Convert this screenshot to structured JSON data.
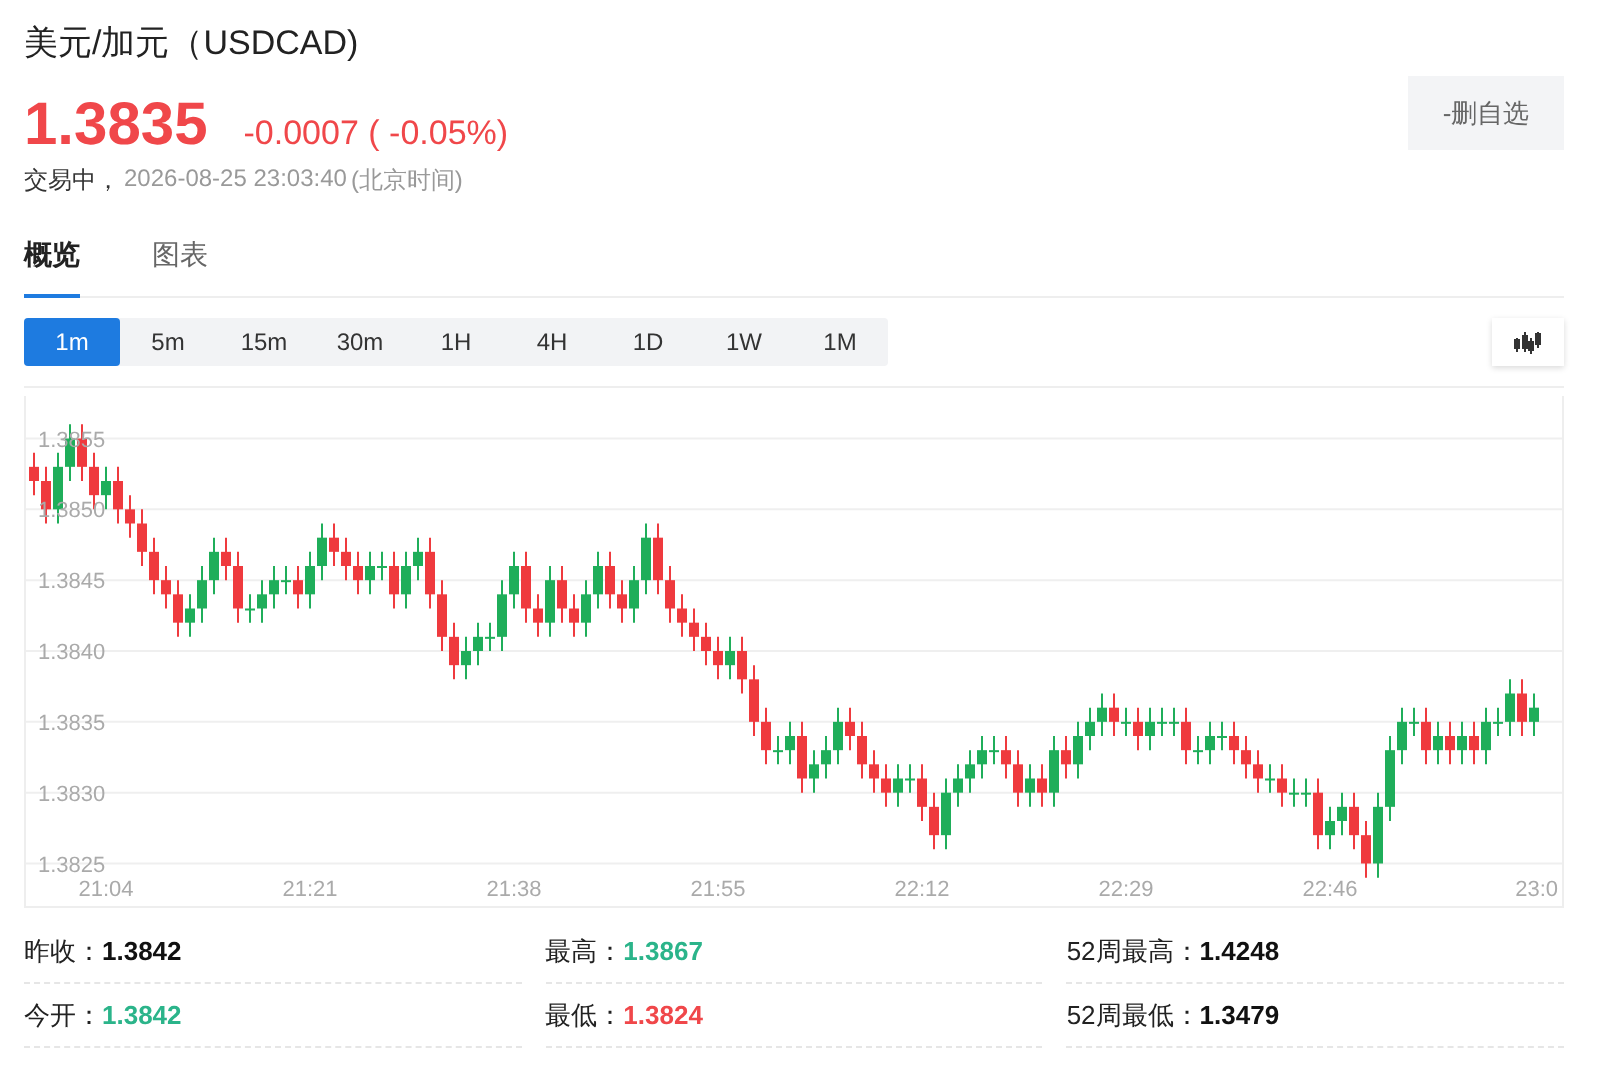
{
  "header": {
    "title": "美元/加元（USDCAD)",
    "price": "1.3835",
    "change": "-0.0007 ( -0.05%)",
    "status": "交易中，",
    "time": "2026-08-25 23:03:40",
    "timezone": "(北京时间)",
    "watch_button": "-删自选"
  },
  "tabs": [
    {
      "label": "概览",
      "selected": true
    },
    {
      "label": "图表",
      "selected": false
    }
  ],
  "intervals": [
    {
      "label": "1m",
      "selected": true
    },
    {
      "label": "5m",
      "selected": false
    },
    {
      "label": "15m",
      "selected": false
    },
    {
      "label": "30m",
      "selected": false
    },
    {
      "label": "1H",
      "selected": false
    },
    {
      "label": "4H",
      "selected": false
    },
    {
      "label": "1D",
      "selected": false
    },
    {
      "label": "1W",
      "selected": false
    },
    {
      "label": "1M",
      "selected": false
    }
  ],
  "chart": {
    "chart_data": {
      "type": "candlestick",
      "ylim": [
        1.3822,
        1.3858
      ],
      "grid": true,
      "categories": [
        null,
        null,
        null,
        null,
        null,
        null,
        "21:04",
        null,
        null,
        null,
        null,
        null,
        null,
        null,
        null,
        null,
        null,
        null,
        null,
        null,
        null,
        null,
        null,
        "21:21",
        null,
        null,
        null,
        null,
        null,
        null,
        null,
        null,
        null,
        null,
        null,
        null,
        null,
        null,
        null,
        null,
        "21:38",
        null,
        null,
        null,
        null,
        null,
        null,
        null,
        null,
        null,
        null,
        null,
        null,
        null,
        null,
        null,
        null,
        "21:55",
        null,
        null,
        null,
        null,
        null,
        null,
        null,
        null,
        null,
        null,
        null,
        null,
        null,
        null,
        null,
        null,
        "22:12",
        null,
        null,
        null,
        null,
        null,
        null,
        null,
        null,
        null,
        null,
        null,
        null,
        null,
        null,
        null,
        null,
        "22:29",
        null,
        null,
        null,
        null,
        null,
        null,
        null,
        null,
        null,
        null,
        null,
        null,
        null,
        null,
        null,
        null,
        "22:46",
        null,
        null,
        null,
        null,
        null,
        null,
        null,
        null,
        null,
        null,
        null,
        null,
        null,
        null,
        null,
        null,
        "23:0"
      ],
      "yticks": [
        {
          "value": 1.3855,
          "label": "1.3855"
        },
        {
          "value": 1.385,
          "label": "1.3850"
        },
        {
          "value": 1.3845,
          "label": "1.3845"
        },
        {
          "value": 1.384,
          "label": "1.3840"
        },
        {
          "value": 1.3835,
          "label": "1.3835"
        },
        {
          "value": 1.383,
          "label": "1.3830"
        },
        {
          "value": 1.3825,
          "label": "1.3825"
        }
      ],
      "ohlc": [
        [
          1.3853,
          1.3854,
          1.3851,
          1.3852
        ],
        [
          1.3852,
          1.3853,
          1.3849,
          1.385
        ],
        [
          1.385,
          1.3854,
          1.3849,
          1.3853
        ],
        [
          1.3853,
          1.3856,
          1.3852,
          1.3855
        ],
        [
          1.3855,
          1.3856,
          1.3852,
          1.3853
        ],
        [
          1.3853,
          1.3854,
          1.385,
          1.3851
        ],
        [
          1.3851,
          1.3853,
          1.385,
          1.3852
        ],
        [
          1.3852,
          1.3853,
          1.3849,
          1.385
        ],
        [
          1.385,
          1.3851,
          1.3848,
          1.3849
        ],
        [
          1.3849,
          1.385,
          1.3846,
          1.3847
        ],
        [
          1.3847,
          1.3848,
          1.3844,
          1.3845
        ],
        [
          1.3845,
          1.3846,
          1.3843,
          1.3844
        ],
        [
          1.3844,
          1.3845,
          1.3841,
          1.3842
        ],
        [
          1.3842,
          1.3844,
          1.3841,
          1.3843
        ],
        [
          1.3843,
          1.3846,
          1.3842,
          1.3845
        ],
        [
          1.3845,
          1.3848,
          1.3844,
          1.3847
        ],
        [
          1.3847,
          1.3848,
          1.3845,
          1.3846
        ],
        [
          1.3846,
          1.3847,
          1.3842,
          1.3843
        ],
        [
          1.3843,
          1.3844,
          1.3842,
          1.3843
        ],
        [
          1.3843,
          1.3845,
          1.3842,
          1.3844
        ],
        [
          1.3844,
          1.3846,
          1.3843,
          1.3845
        ],
        [
          1.3845,
          1.3846,
          1.3844,
          1.3845
        ],
        [
          1.3845,
          1.3846,
          1.3843,
          1.3844
        ],
        [
          1.3844,
          1.3847,
          1.3843,
          1.3846
        ],
        [
          1.3846,
          1.3849,
          1.3845,
          1.3848
        ],
        [
          1.3848,
          1.3849,
          1.3846,
          1.3847
        ],
        [
          1.3847,
          1.3848,
          1.3845,
          1.3846
        ],
        [
          1.3846,
          1.3847,
          1.3844,
          1.3845
        ],
        [
          1.3845,
          1.3847,
          1.3844,
          1.3846
        ],
        [
          1.3846,
          1.3847,
          1.3845,
          1.3846
        ],
        [
          1.3846,
          1.3847,
          1.3843,
          1.3844
        ],
        [
          1.3844,
          1.3847,
          1.3843,
          1.3846
        ],
        [
          1.3846,
          1.3848,
          1.3845,
          1.3847
        ],
        [
          1.3847,
          1.3848,
          1.3843,
          1.3844
        ],
        [
          1.3844,
          1.3845,
          1.384,
          1.3841
        ],
        [
          1.3841,
          1.3842,
          1.3838,
          1.3839
        ],
        [
          1.3839,
          1.3841,
          1.3838,
          1.384
        ],
        [
          1.384,
          1.3842,
          1.3839,
          1.3841
        ],
        [
          1.3841,
          1.3842,
          1.384,
          1.3841
        ],
        [
          1.3841,
          1.3845,
          1.384,
          1.3844
        ],
        [
          1.3844,
          1.3847,
          1.3843,
          1.3846
        ],
        [
          1.3846,
          1.3847,
          1.3842,
          1.3843
        ],
        [
          1.3843,
          1.3844,
          1.3841,
          1.3842
        ],
        [
          1.3842,
          1.3846,
          1.3841,
          1.3845
        ],
        [
          1.3845,
          1.3846,
          1.3842,
          1.3843
        ],
        [
          1.3843,
          1.3844,
          1.3841,
          1.3842
        ],
        [
          1.3842,
          1.3845,
          1.3841,
          1.3844
        ],
        [
          1.3844,
          1.3847,
          1.3843,
          1.3846
        ],
        [
          1.3846,
          1.3847,
          1.3843,
          1.3844
        ],
        [
          1.3844,
          1.3845,
          1.3842,
          1.3843
        ],
        [
          1.3843,
          1.3846,
          1.3842,
          1.3845
        ],
        [
          1.3845,
          1.3849,
          1.3844,
          1.3848
        ],
        [
          1.3848,
          1.3849,
          1.3844,
          1.3845
        ],
        [
          1.3845,
          1.3846,
          1.3842,
          1.3843
        ],
        [
          1.3843,
          1.3844,
          1.3841,
          1.3842
        ],
        [
          1.3842,
          1.3843,
          1.384,
          1.3841
        ],
        [
          1.3841,
          1.3842,
          1.3839,
          1.384
        ],
        [
          1.384,
          1.3841,
          1.3838,
          1.3839
        ],
        [
          1.3839,
          1.3841,
          1.3838,
          1.384
        ],
        [
          1.384,
          1.3841,
          1.3837,
          1.3838
        ],
        [
          1.3838,
          1.3839,
          1.3834,
          1.3835
        ],
        [
          1.3835,
          1.3836,
          1.3832,
          1.3833
        ],
        [
          1.3833,
          1.3834,
          1.3832,
          1.3833
        ],
        [
          1.3833,
          1.3835,
          1.3832,
          1.3834
        ],
        [
          1.3834,
          1.3835,
          1.383,
          1.3831
        ],
        [
          1.3831,
          1.3833,
          1.383,
          1.3832
        ],
        [
          1.3832,
          1.3834,
          1.3831,
          1.3833
        ],
        [
          1.3833,
          1.3836,
          1.3832,
          1.3835
        ],
        [
          1.3835,
          1.3836,
          1.3833,
          1.3834
        ],
        [
          1.3834,
          1.3835,
          1.3831,
          1.3832
        ],
        [
          1.3832,
          1.3833,
          1.383,
          1.3831
        ],
        [
          1.3831,
          1.3832,
          1.3829,
          1.383
        ],
        [
          1.383,
          1.3832,
          1.3829,
          1.3831
        ],
        [
          1.3831,
          1.3832,
          1.383,
          1.3831
        ],
        [
          1.3831,
          1.3832,
          1.3828,
          1.3829
        ],
        [
          1.3829,
          1.383,
          1.3826,
          1.3827
        ],
        [
          1.3827,
          1.3831,
          1.3826,
          1.383
        ],
        [
          1.383,
          1.3832,
          1.3829,
          1.3831
        ],
        [
          1.3831,
          1.3833,
          1.383,
          1.3832
        ],
        [
          1.3832,
          1.3834,
          1.3831,
          1.3833
        ],
        [
          1.3833,
          1.3834,
          1.3832,
          1.3833
        ],
        [
          1.3833,
          1.3834,
          1.3831,
          1.3832
        ],
        [
          1.3832,
          1.3833,
          1.3829,
          1.383
        ],
        [
          1.383,
          1.3832,
          1.3829,
          1.3831
        ],
        [
          1.3831,
          1.3832,
          1.3829,
          1.383
        ],
        [
          1.383,
          1.3834,
          1.3829,
          1.3833
        ],
        [
          1.3833,
          1.3834,
          1.3831,
          1.3832
        ],
        [
          1.3832,
          1.3835,
          1.3831,
          1.3834
        ],
        [
          1.3834,
          1.3836,
          1.3833,
          1.3835
        ],
        [
          1.3835,
          1.3837,
          1.3834,
          1.3836
        ],
        [
          1.3836,
          1.3837,
          1.3834,
          1.3835
        ],
        [
          1.3835,
          1.3836,
          1.3834,
          1.3835
        ],
        [
          1.3835,
          1.3836,
          1.3833,
          1.3834
        ],
        [
          1.3834,
          1.3836,
          1.3833,
          1.3835
        ],
        [
          1.3835,
          1.3836,
          1.3834,
          1.3835
        ],
        [
          1.3835,
          1.3836,
          1.3834,
          1.3835
        ],
        [
          1.3835,
          1.3836,
          1.3832,
          1.3833
        ],
        [
          1.3833,
          1.3834,
          1.3832,
          1.3833
        ],
        [
          1.3833,
          1.3835,
          1.3832,
          1.3834
        ],
        [
          1.3834,
          1.3835,
          1.3833,
          1.3834
        ],
        [
          1.3834,
          1.3835,
          1.3832,
          1.3833
        ],
        [
          1.3833,
          1.3834,
          1.3831,
          1.3832
        ],
        [
          1.3832,
          1.3833,
          1.383,
          1.3831
        ],
        [
          1.3831,
          1.3832,
          1.383,
          1.3831
        ],
        [
          1.3831,
          1.3832,
          1.3829,
          1.383
        ],
        [
          1.383,
          1.3831,
          1.3829,
          1.383
        ],
        [
          1.383,
          1.3831,
          1.3829,
          1.383
        ],
        [
          1.383,
          1.3831,
          1.3826,
          1.3827
        ],
        [
          1.3827,
          1.3829,
          1.3826,
          1.3828
        ],
        [
          1.3828,
          1.383,
          1.3827,
          1.3829
        ],
        [
          1.3829,
          1.383,
          1.3826,
          1.3827
        ],
        [
          1.3827,
          1.3828,
          1.3824,
          1.3825
        ],
        [
          1.3825,
          1.383,
          1.3824,
          1.3829
        ],
        [
          1.3829,
          1.3834,
          1.3828,
          1.3833
        ],
        [
          1.3833,
          1.3836,
          1.3832,
          1.3835
        ],
        [
          1.3835,
          1.3836,
          1.3834,
          1.3835
        ],
        [
          1.3835,
          1.3836,
          1.3832,
          1.3833
        ],
        [
          1.3833,
          1.3835,
          1.3832,
          1.3834
        ],
        [
          1.3834,
          1.3835,
          1.3832,
          1.3833
        ],
        [
          1.3833,
          1.3835,
          1.3832,
          1.3834
        ],
        [
          1.3834,
          1.3835,
          1.3832,
          1.3833
        ],
        [
          1.3833,
          1.3836,
          1.3832,
          1.3835
        ],
        [
          1.3835,
          1.3836,
          1.3834,
          1.3835
        ],
        [
          1.3835,
          1.3838,
          1.3834,
          1.3837
        ],
        [
          1.3837,
          1.3838,
          1.3834,
          1.3835
        ],
        [
          1.3835,
          1.3837,
          1.3834,
          1.3836
        ]
      ]
    }
  },
  "stats": [
    {
      "label": "昨收：",
      "value": "1.3842",
      "kind": "plain"
    },
    {
      "label": "最高：",
      "value": "1.3867",
      "kind": "up"
    },
    {
      "label": "52周最高：",
      "value": "1.4248",
      "kind": "plain"
    },
    {
      "label": "今开：",
      "value": "1.3842",
      "kind": "up"
    },
    {
      "label": "最低：",
      "value": "1.3824",
      "kind": "down"
    },
    {
      "label": "52周最低：",
      "value": "1.3479",
      "kind": "plain"
    }
  ]
}
